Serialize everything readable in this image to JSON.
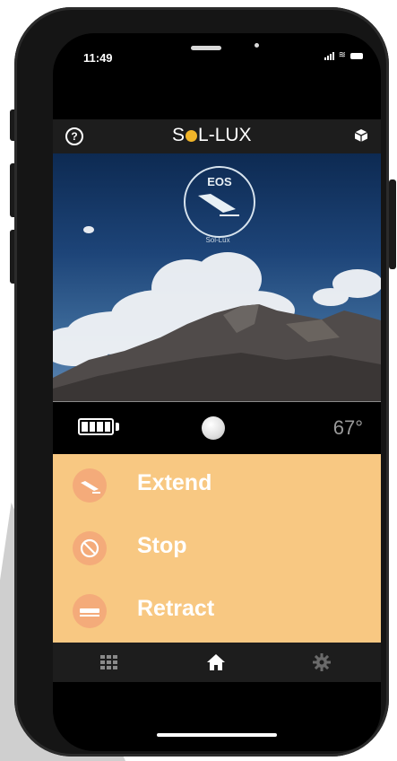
{
  "status_bar": {
    "time": "11:49"
  },
  "header": {
    "logo_prefix": "S",
    "logo_suffix": "L-LUX",
    "help_label": "?"
  },
  "hero": {
    "badge_title": "EOS",
    "badge_subtitle": "Sol-Lux"
  },
  "info": {
    "temperature": "67°",
    "battery_bars": 4
  },
  "controls": [
    {
      "label": "Extend",
      "icon": "awning-extend-icon"
    },
    {
      "label": "Stop",
      "icon": "stop-icon"
    },
    {
      "label": "Retract",
      "icon": "awning-retract-icon"
    }
  ],
  "tabbar": {
    "items": [
      "grid-icon",
      "home-icon",
      "gear-icon"
    ]
  },
  "colors": {
    "accent": "#f8c882",
    "icon_bg": "#f4ab7a",
    "sun": "#f0b429"
  }
}
